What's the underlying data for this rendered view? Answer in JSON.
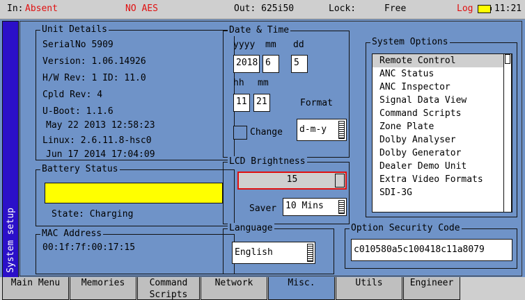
{
  "status": {
    "input_label": "In:",
    "input_value": "Absent",
    "audio": "NO AES",
    "output": "Out: 625i50",
    "lock_label": "Lock:",
    "lock_value": "Free",
    "log": "Log",
    "time": "11:21"
  },
  "side_tab": "System setup",
  "unit_details": {
    "title": "Unit Details",
    "serial": "SerialNo  5909",
    "version": "Version:  1.06.14926",
    "hw_rev": "H/W Rev:  1    ID: 11.0",
    "cpld": "Cpld Rev: 4",
    "uboot": "U-Boot:   1.1.6",
    "uboot_date": "May 22 2013 12:58:23",
    "linux": "Linux:     2.6.11.8-hsc0",
    "linux_date": "Jun 17 2014 17:04:09"
  },
  "battery": {
    "title": "Battery Status",
    "level": 1.0,
    "bar_color": "#ffff00",
    "state": "State:  Charging"
  },
  "mac": {
    "title": "MAC Address",
    "value": "00:1f:7f:00:17:15"
  },
  "datetime": {
    "title": "Date & Time",
    "yyyy_label": "yyyy",
    "mm_label": "mm",
    "dd_label": "dd",
    "year": "2018",
    "month": "6",
    "day": "5",
    "hh_label": "hh",
    "min_label": "mm",
    "hour": "11",
    "minute": "21",
    "format_label": "Format",
    "change_label": "Change",
    "format_value": "d-m-y"
  },
  "lcd": {
    "title": "LCD Brightness",
    "brightness": "15",
    "saver_label": "Saver",
    "saver_value": "10 Mins"
  },
  "language": {
    "title": "Language",
    "value": "English"
  },
  "system_options": {
    "title": "System Options",
    "items": [
      "Remote Control",
      "ANC Status",
      "ANC Inspector",
      "Signal Data View",
      "Command Scripts",
      "Zone Plate",
      "Dolby Analyser",
      "Dolby Generator",
      "Dealer Demo Unit",
      "Extra Video Formats",
      "SDI-3G"
    ]
  },
  "option_security": {
    "title": "Option Security Code",
    "value": "c010580a5c100418c11a8079"
  },
  "tabs": [
    "Main Menu",
    "Memories",
    "Command Scripts",
    "Network",
    "Misc.",
    "Utils",
    "Engineer"
  ],
  "colors": {
    "accent_red": "#e01010",
    "panel_blue": "#6f93c8",
    "side_tab_blue": "#2b10c9"
  }
}
